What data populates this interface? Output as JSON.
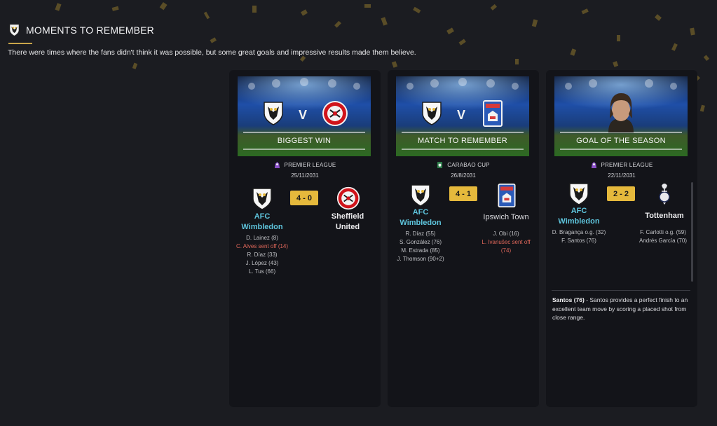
{
  "header": {
    "title": "MOMENTS TO REMEMBER",
    "subtitle": "There were times where the fans didn't think it was possible, but some great goals and impressive results made them believe."
  },
  "colors": {
    "gold": "#e5b93c",
    "home_team": "#5ec4dc",
    "sent_off": "#e0675a",
    "card_bg": "#131419"
  },
  "cards": [
    {
      "label": "BIGGEST WIN",
      "versus": "V",
      "competition": "PREMIER LEAGUE",
      "competition_icon": "premier-league-icon",
      "date": "25/11/2031",
      "score": "4 - 0",
      "home": {
        "name_line1": "AFC",
        "name_line2": "Wimbledon",
        "crest": "afc-wimbledon-crest-icon"
      },
      "away": {
        "name_line1": "Sheffield",
        "name_line2": "United",
        "crest": "sheffield-united-crest-icon"
      },
      "home_events": [
        "D. Lainez (8)",
        "C. Alves sent off (14)",
        "R. Díaz (33)",
        "J. López (43)",
        "L. Tus (66)"
      ],
      "away_events": []
    },
    {
      "label": "MATCH TO REMEMBER",
      "versus": "V",
      "competition": "CARABAO CUP",
      "competition_icon": "carabao-cup-icon",
      "date": "26/8/2031",
      "score": "4 - 1",
      "home": {
        "name_line1": "AFC",
        "name_line2": "Wimbledon",
        "crest": "afc-wimbledon-crest-icon"
      },
      "away": {
        "name_line1": "Ipswich Town",
        "crest": "ipswich-town-crest-icon"
      },
      "home_events": [
        "R. Díaz (55)",
        "S. González (76)",
        "M. Estrada (85)",
        "J. Thomson (90+2)"
      ],
      "away_events": [
        "J. Obi (16)",
        "L. Ivanušec sent off",
        "(74)"
      ]
    },
    {
      "label": "GOAL OF THE SEASON",
      "competition": "PREMIER LEAGUE",
      "competition_icon": "premier-league-icon",
      "date": "22/11/2031",
      "score": "2 - 2",
      "home": {
        "name_line1": "AFC",
        "name_line2": "Wimbledon",
        "crest": "afc-wimbledon-crest-icon"
      },
      "away": {
        "name_line1": "Tottenham",
        "crest": "tottenham-crest-icon"
      },
      "home_events": [
        "D. Bragança o.g. (32)",
        "F. Santos (76)"
      ],
      "away_events": [
        "F. Carlotti o.g. (59)",
        "Andrés García (70)"
      ],
      "description_player": "Santos (76)",
      "description_text": " - Santos provides a perfect finish to an excellent team move by scoring a placed shot from close range."
    }
  ]
}
